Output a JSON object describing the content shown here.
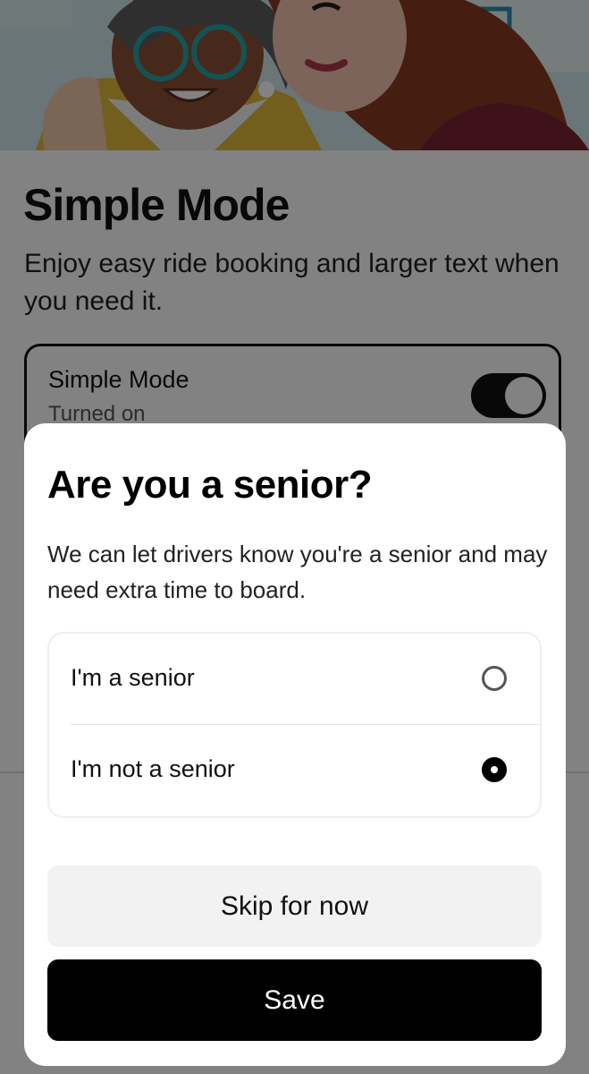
{
  "page": {
    "title": "Simple Mode",
    "description": "Enjoy easy ride booking and larger text when you need it.",
    "setting": {
      "title": "Simple Mode",
      "status": "Turned on",
      "enabled": true
    }
  },
  "sheet": {
    "title": "Are you a senior?",
    "description": "We can let drivers know you're a senior and may need extra time to board.",
    "options": [
      {
        "label": "I'm a senior",
        "selected": false
      },
      {
        "label": "I'm not a senior",
        "selected": true
      }
    ],
    "skip_label": "Skip for now",
    "save_label": "Save"
  },
  "colors": {
    "primary": "#000000",
    "secondary_button": "#f2f2f2",
    "scrim": "rgba(0,0,0,0.49)"
  },
  "icons": [
    "radio-unselected-icon",
    "radio-selected-icon",
    "toggle-switch"
  ]
}
